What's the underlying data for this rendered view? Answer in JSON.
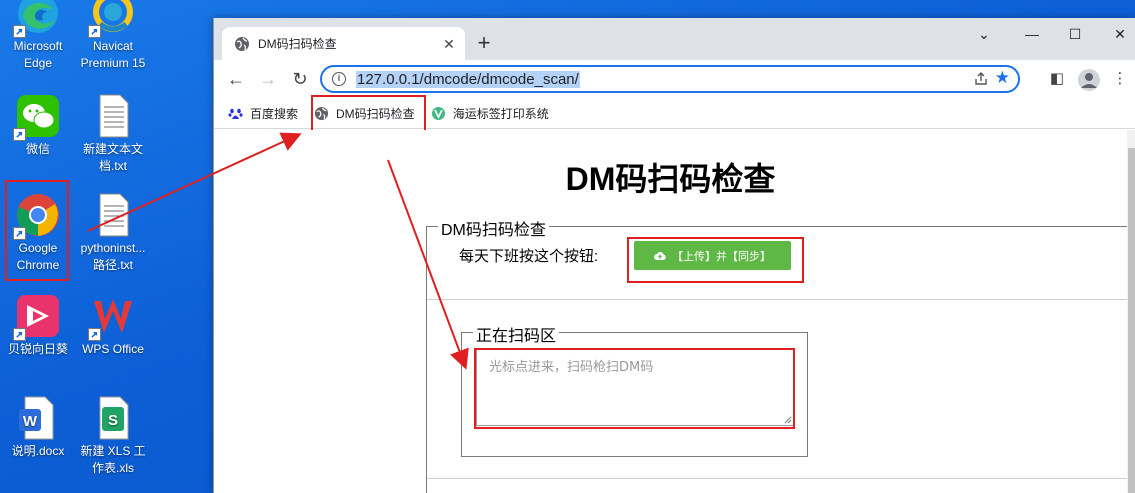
{
  "desktop": {
    "icons": [
      {
        "label_line1": "Microsoft",
        "label_line2": "Edge"
      },
      {
        "label_line1": "Navicat",
        "label_line2": "Premium 15"
      },
      {
        "label_line1": "微信",
        "label_line2": ""
      },
      {
        "label_line1": "新建文本文",
        "label_line2": "档.txt"
      },
      {
        "label_line1": "Google",
        "label_line2": "Chrome"
      },
      {
        "label_line1": "pythoninst...",
        "label_line2": "路径.txt"
      },
      {
        "label_line1": "贝锐向日葵",
        "label_line2": ""
      },
      {
        "label_line1": "WPS Office",
        "label_line2": ""
      },
      {
        "label_line1": "说明.docx",
        "label_line2": ""
      },
      {
        "label_line1": "新建 XLS 工",
        "label_line2": "作表.xls"
      }
    ]
  },
  "browser": {
    "tab_title": "DM码扫码检查",
    "url": "127.0.0.1/dmcode/dmcode_scan/",
    "bookmarks": [
      {
        "label": "百度搜索",
        "icon": "baidu-paw-icon"
      },
      {
        "label": "DM码扫码检查",
        "icon": "globe-icon"
      },
      {
        "label": "海运标签打印系统",
        "icon": "v-logo-icon"
      }
    ]
  },
  "page": {
    "heading": "DM码扫码检查",
    "outer_legend": "DM码扫码检查",
    "instruction": "每天下班按这个按钮:",
    "sync_button": "【上传】并【同步】",
    "inner_legend": "正在扫码区",
    "scan_placeholder": "光标点进来，扫码枪扫DM码"
  },
  "colors": {
    "highlight": "#e02020",
    "button_green": "#5fb846",
    "omnibox_focus": "#1a73e8"
  }
}
